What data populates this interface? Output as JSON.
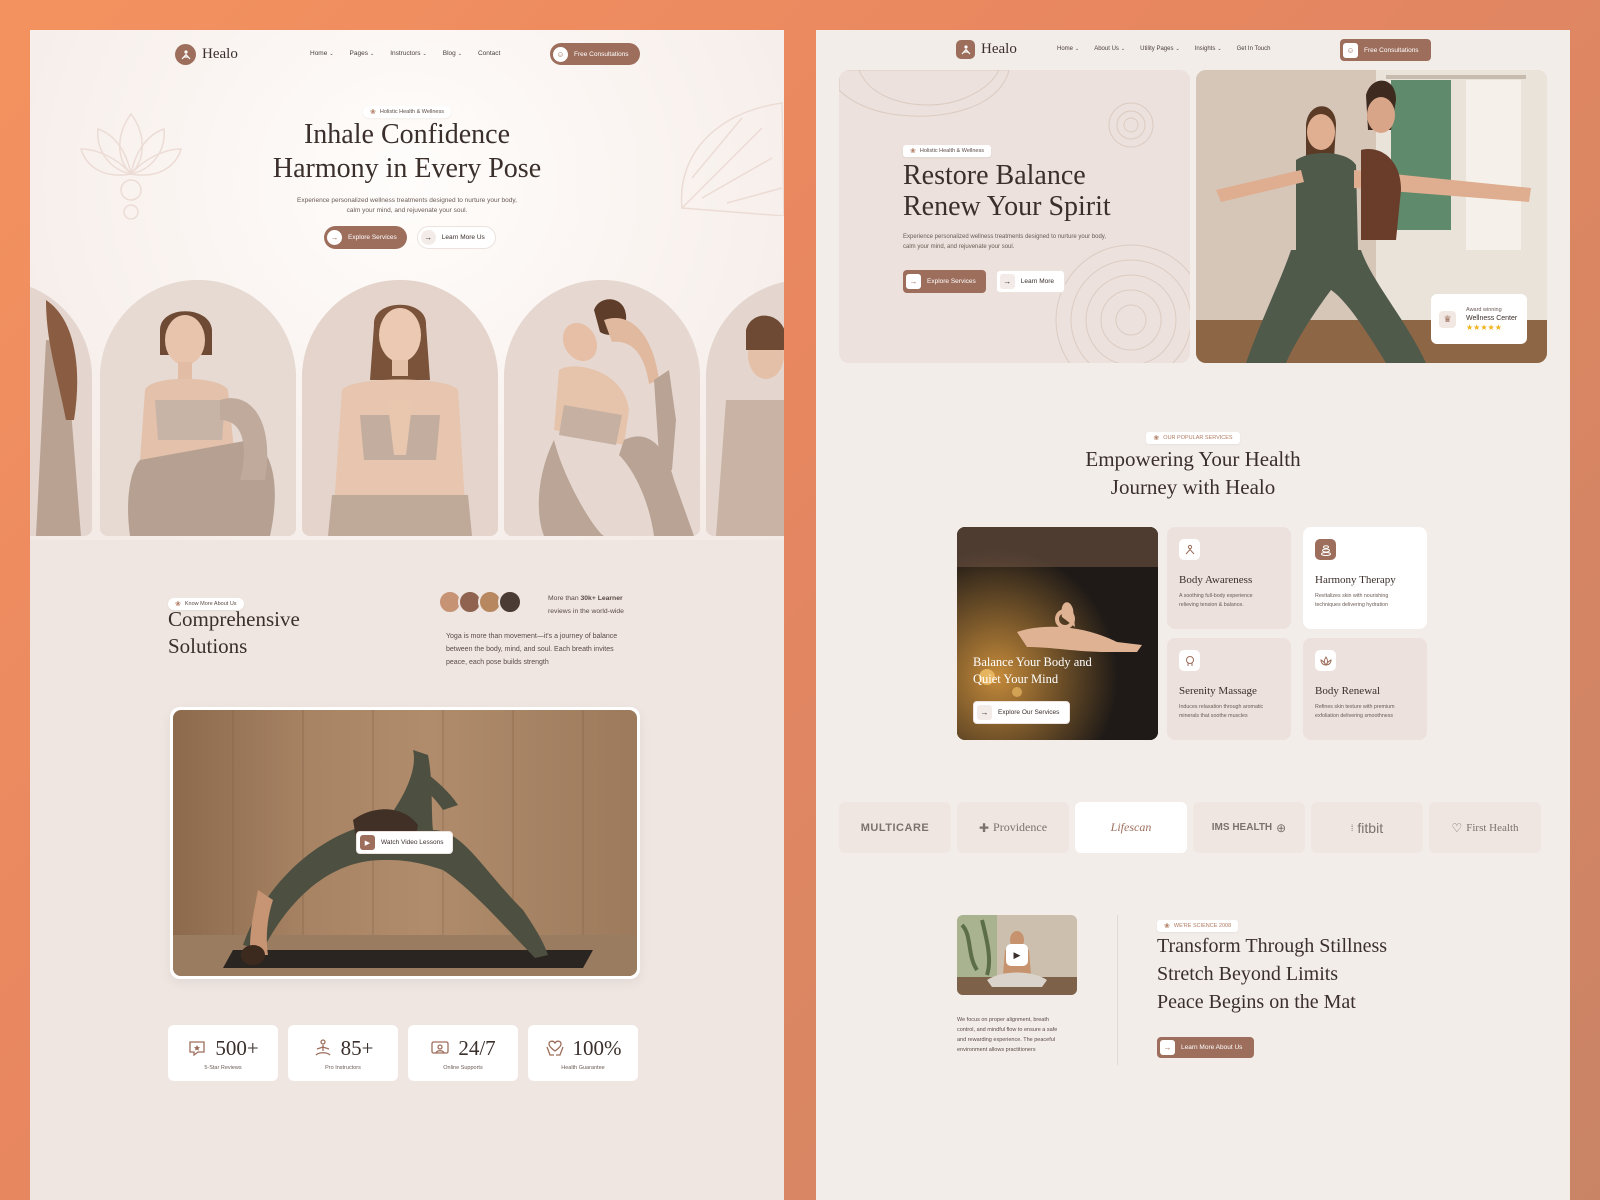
{
  "left": {
    "logo_text": "Healo",
    "nav": [
      {
        "label": "Home",
        "caret": true
      },
      {
        "label": "Pages",
        "caret": true
      },
      {
        "label": "Instructors",
        "caret": true
      },
      {
        "label": "Blog",
        "caret": true
      },
      {
        "label": "Contact",
        "caret": false
      }
    ],
    "cta": "Free Consultations",
    "hero": {
      "badge": "Holistic Health & Wellness",
      "title_1": "Inhale Confidence",
      "title_2": "Harmony in Every Pose",
      "subtitle_1": "Experience personalized wellness treatments designed to nurture your body,",
      "subtitle_2": "calm your mind, and rejuvenate your soul.",
      "btn_primary": "Explore Services",
      "btn_secondary": "Learn More Us"
    },
    "about": {
      "badge": "Know More About Us",
      "title_1": "Comprehensive",
      "title_2": "Solutions",
      "learners_prefix": "More than ",
      "learners_bold": "30k+ Learner",
      "learners_suffix": "reviews in the world-wide",
      "body_1": "Yoga is more than movement—it's a journey of balance",
      "body_2": "between the body, mind, and soul. Each breath invites",
      "body_3": "peace, each pose builds strength",
      "video_label": "Watch Video Lessons"
    },
    "stats": [
      {
        "value": "500+",
        "label": "5-Star Reviews",
        "icon": "review-icon"
      },
      {
        "value": "85+",
        "label": "Pro Instructors",
        "icon": "meditation-icon"
      },
      {
        "value": "24/7",
        "label": "Online Supports",
        "icon": "support-icon"
      },
      {
        "value": "100%",
        "label": "Health Guarantee",
        "icon": "hands-icon"
      }
    ]
  },
  "right": {
    "logo_text": "Healo",
    "nav": [
      {
        "label": "Home",
        "caret": true
      },
      {
        "label": "About Us",
        "caret": true
      },
      {
        "label": "Utility Pages",
        "caret": true
      },
      {
        "label": "Insights",
        "caret": true
      },
      {
        "label": "Get In Touch",
        "caret": false
      }
    ],
    "cta": "Free Consultations",
    "hero": {
      "badge": "Holistic Health & Wellness",
      "title_1": "Restore Balance",
      "title_2": "Renew Your Spirit",
      "subtitle_1": "Experience personalized wellness treatments designed to nurture your body,",
      "subtitle_2": "calm your mind, and rejuvenate your soul.",
      "btn_primary": "Explore Services",
      "btn_secondary": "Learn More",
      "award_1": "Award winning",
      "award_2": "Wellness Center",
      "stars": "★★★★★"
    },
    "services": {
      "badge": "OUR POPULAR SERVICES",
      "title_1": "Empowering Your Health",
      "title_2": "Journey with Healo",
      "feature_title_1": "Balance Your Body and",
      "feature_title_2": "Quiet Your Mind",
      "feature_btn": "Explore Our Services",
      "cards": [
        {
          "title": "Body Awareness",
          "desc_1": "A soothing full-body experience",
          "desc_2": "relieving tension & balance."
        },
        {
          "title": "Harmony Therapy",
          "desc_1": "Revitalizes skin with nourishing",
          "desc_2": "techniques delivering hydration"
        },
        {
          "title": "Serenity Massage",
          "desc_1": "Induces relaxation through aromatic",
          "desc_2": "minerals that soothe muscles"
        },
        {
          "title": "Body Renewal",
          "desc_1": "Refines skin texture with premium",
          "desc_2": "exfoliation delivering smoothness"
        }
      ]
    },
    "brands": [
      "MULTICARE",
      "Providence",
      "Lifescan",
      "IMS HEALTH",
      "fitbit",
      "First Health"
    ],
    "about": {
      "badge": "WE'RE SCIENCE 2008",
      "title_1": "Transform Through Stillness",
      "title_2": "Stretch Beyond Limits",
      "title_3": "Peace Begins on the Mat",
      "body_1": "We focus on proper alignment, breath",
      "body_2": "control, and mindful flow to ensure a safe",
      "body_3": "and rewarding experience. The peaceful",
      "body_4": "environment allows practitioners",
      "btn": "Learn More About Us"
    }
  },
  "colors": {
    "accent": "#9d6e5c",
    "background": "#f4925f",
    "star": "#f2b21b"
  }
}
